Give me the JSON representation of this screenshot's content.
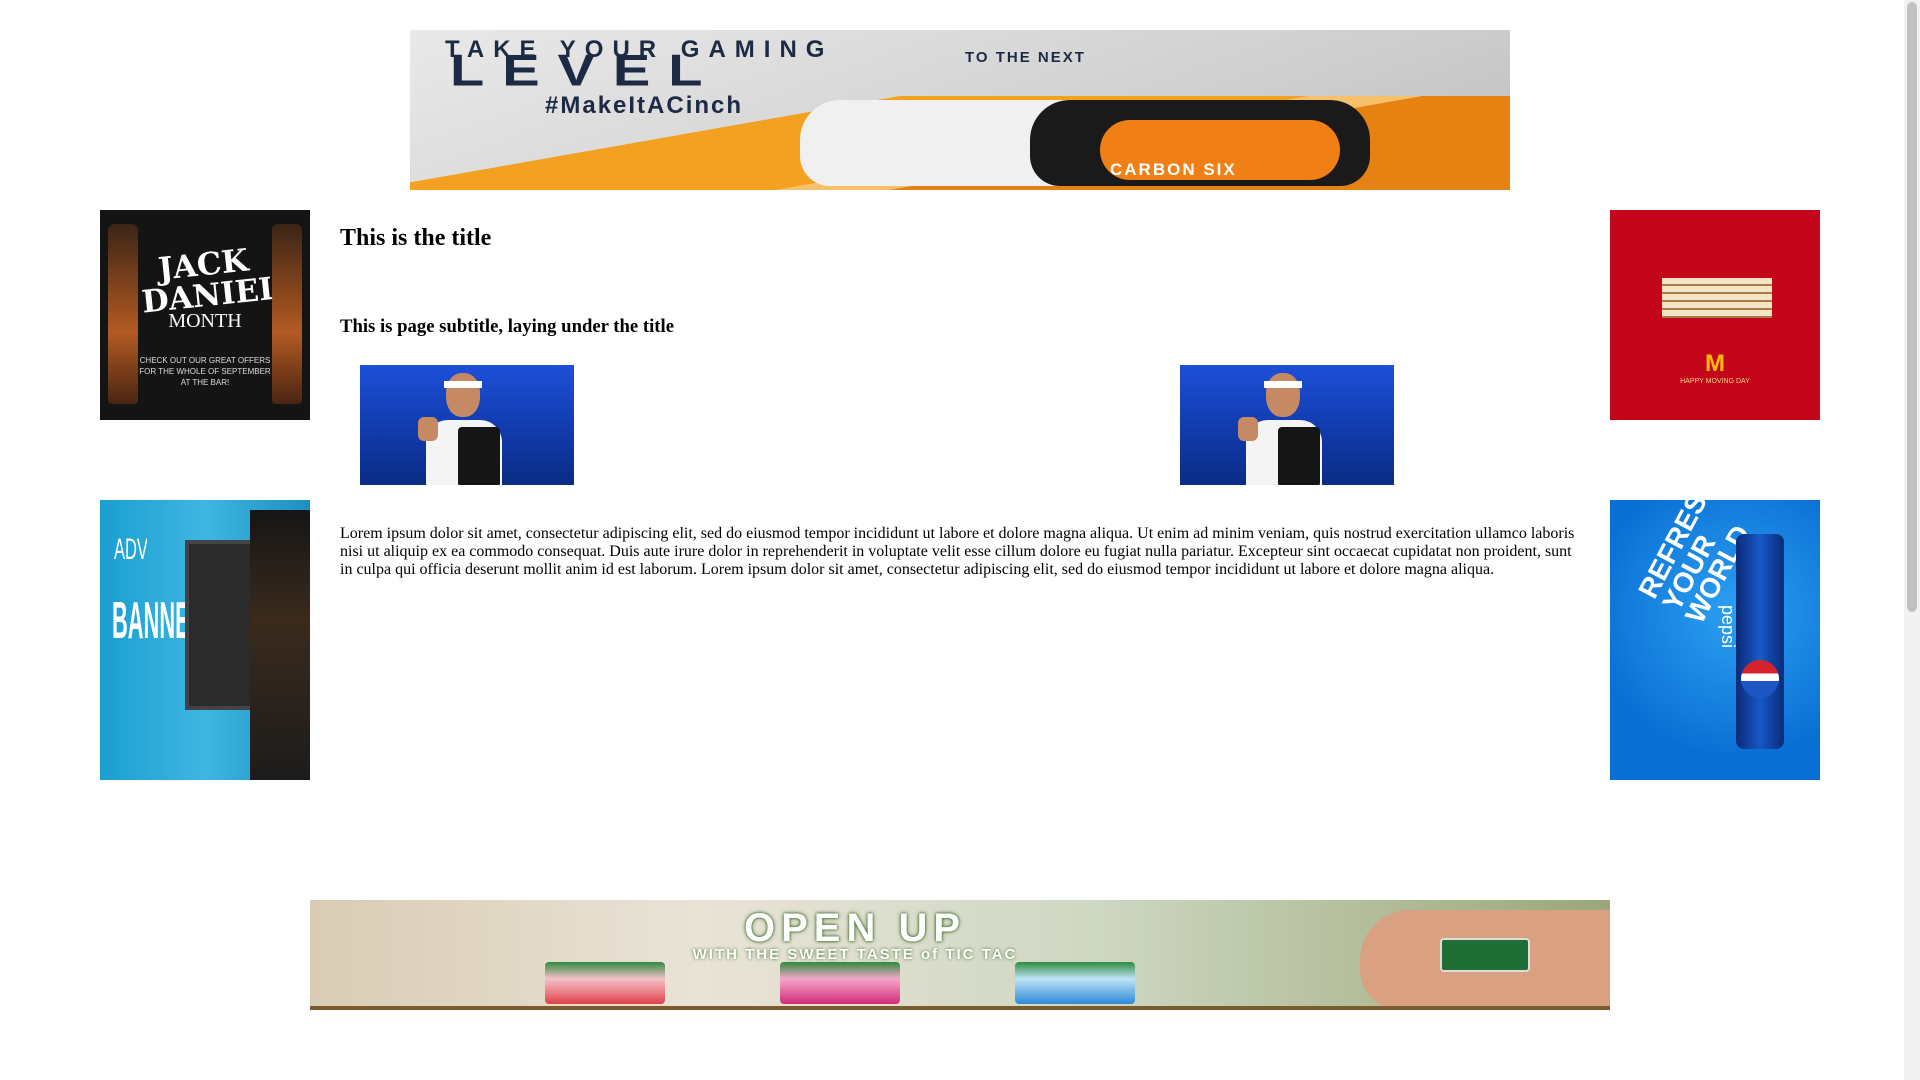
{
  "ads": {
    "top_banner": {
      "line1": "TAKE YOUR GAMING",
      "line2": "LEVEL",
      "line3": "TO THE NEXT",
      "hashtag": "#MakeItACinch",
      "brand": "CARBON SIX"
    },
    "left_top": {
      "title": "JACK DANIEL'S",
      "subtitle": "MONTH",
      "small": "CHECK OUT OUR GREAT OFFERS FOR THE WHOLE OF SEPTEMBER AT THE BAR!"
    },
    "left_bottom": {
      "word1": "ADVERTISING",
      "word2": "BANNERS"
    },
    "right_top": {
      "logo": "M",
      "caption": "HAPPY MOVING DAY"
    },
    "right_bottom": {
      "slogan": "REFRESH YOUR WORLD",
      "brand": "pepsi"
    },
    "bottom_banner": {
      "headline": "OPEN UP",
      "tagline": "WITH THE SWEET TASTE of TIC TAC"
    }
  },
  "page": {
    "title": "This is the title",
    "subtitle": "This is page subtitle, laying under the title",
    "body": "Lorem ipsum dolor sit amet, consectetur adipiscing elit, sed do eiusmod tempor incididunt ut labore et dolore magna aliqua. Ut enim ad minim veniam, quis nostrud exercitation ullamco laboris nisi ut aliquip ex ea commodo consequat. Duis aute irure dolor in reprehenderit in voluptate velit esse cillum dolore eu fugiat nulla pariatur. Excepteur sint occaecat cupidatat non proident, sunt in culpa qui officia deserunt mollit anim id est laborum. Lorem ipsum dolor sit amet, consectetur adipiscing elit, sed do eiusmod tempor incididunt ut labore et dolore magna aliqua."
  },
  "colors": {
    "mcdonalds_red": "#c3061a",
    "pepsi_blue": "#0a6fd4",
    "page_background": "#ffffff"
  }
}
